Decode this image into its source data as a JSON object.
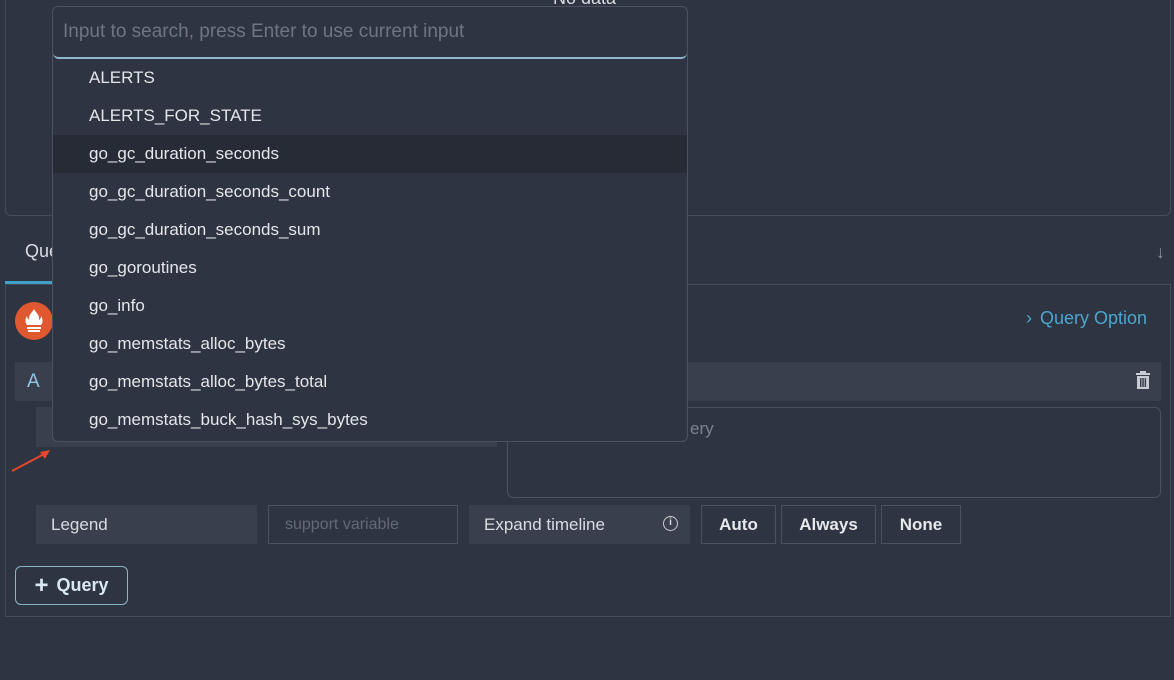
{
  "chart_panel": {
    "empty_text": "No data"
  },
  "tabs": [
    {
      "label": "Query",
      "active": true
    }
  ],
  "query_editor": {
    "query_option_label": "Query Option",
    "query_ref": "A",
    "query_placeholder_visible": "ery",
    "legend_label": "Legend",
    "legend_placeholder": "support variable",
    "expand_timeline_label": "Expand timeline",
    "expand_options": [
      "Auto",
      "Always",
      "None"
    ],
    "add_query_label": "Query"
  },
  "metric_dropdown": {
    "search_placeholder": "Input to search, press Enter to use current input",
    "highlighted_index": 2,
    "items": [
      "ALERTS",
      "ALERTS_FOR_STATE",
      "go_gc_duration_seconds",
      "go_gc_duration_seconds_count",
      "go_gc_duration_seconds_sum",
      "go_goroutines",
      "go_info",
      "go_memstats_alloc_bytes",
      "go_memstats_alloc_bytes_total",
      "go_memstats_buck_hash_sys_bytes"
    ]
  },
  "colors": {
    "accent": "#4aa6cf",
    "prometheus": "#e0582f",
    "annotation_arrow": "#e8452c"
  }
}
